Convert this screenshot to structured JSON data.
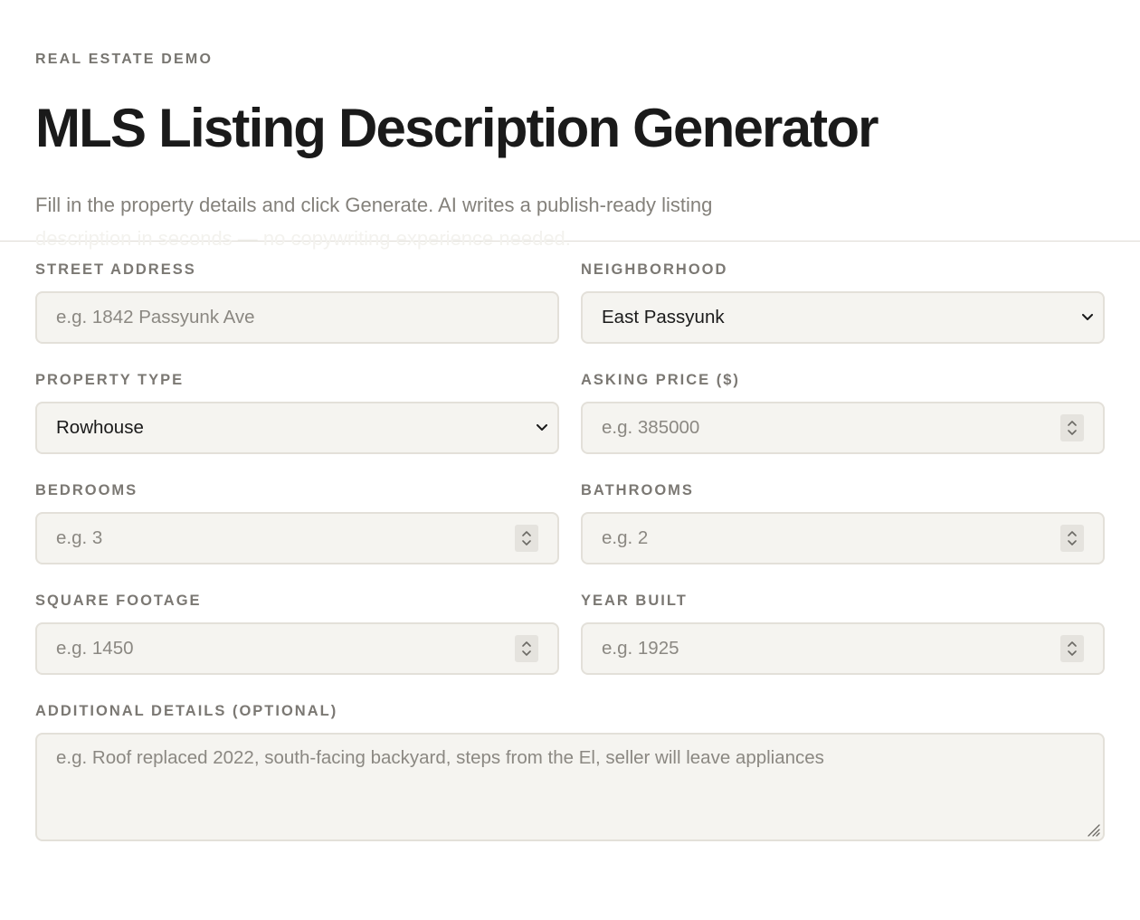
{
  "header": {
    "eyebrow": "REAL ESTATE DEMO",
    "title": "MLS Listing Description Generator",
    "subtitle_line1": "Fill in the property details and click Generate. AI writes a publish-ready listing",
    "subtitle_line2": "description in seconds — no copywriting experience needed."
  },
  "form": {
    "street_address": {
      "label": "STREET ADDRESS",
      "placeholder": "e.g. 1842 Passyunk Ave"
    },
    "neighborhood": {
      "label": "NEIGHBORHOOD",
      "value": "East Passyunk"
    },
    "property_type": {
      "label": "PROPERTY TYPE",
      "value": "Rowhouse"
    },
    "asking_price": {
      "label": "ASKING PRICE ($)",
      "placeholder": "e.g. 385000"
    },
    "bedrooms": {
      "label": "BEDROOMS",
      "placeholder": "e.g. 3"
    },
    "bathrooms": {
      "label": "BATHROOMS",
      "placeholder": "e.g. 2"
    },
    "square_footage": {
      "label": "SQUARE FOOTAGE",
      "placeholder": "e.g. 1450"
    },
    "year_built": {
      "label": "YEAR BUILT",
      "placeholder": "e.g. 1925"
    },
    "additional_details": {
      "label": "ADDITIONAL DETAILS (OPTIONAL)",
      "placeholder": "e.g. Roof replaced 2022, south-facing backyard, steps from the El, seller will leave appliances"
    }
  },
  "icons": {
    "select": "chevron-down-icon",
    "number": "stepper-icon",
    "textarea": "resize-handle-icon"
  },
  "colors": {
    "background": "#ffffff",
    "field_background": "#f5f4f0",
    "field_border": "#e3e0d9",
    "label": "#7b7873",
    "heading": "#1a1a1a"
  }
}
